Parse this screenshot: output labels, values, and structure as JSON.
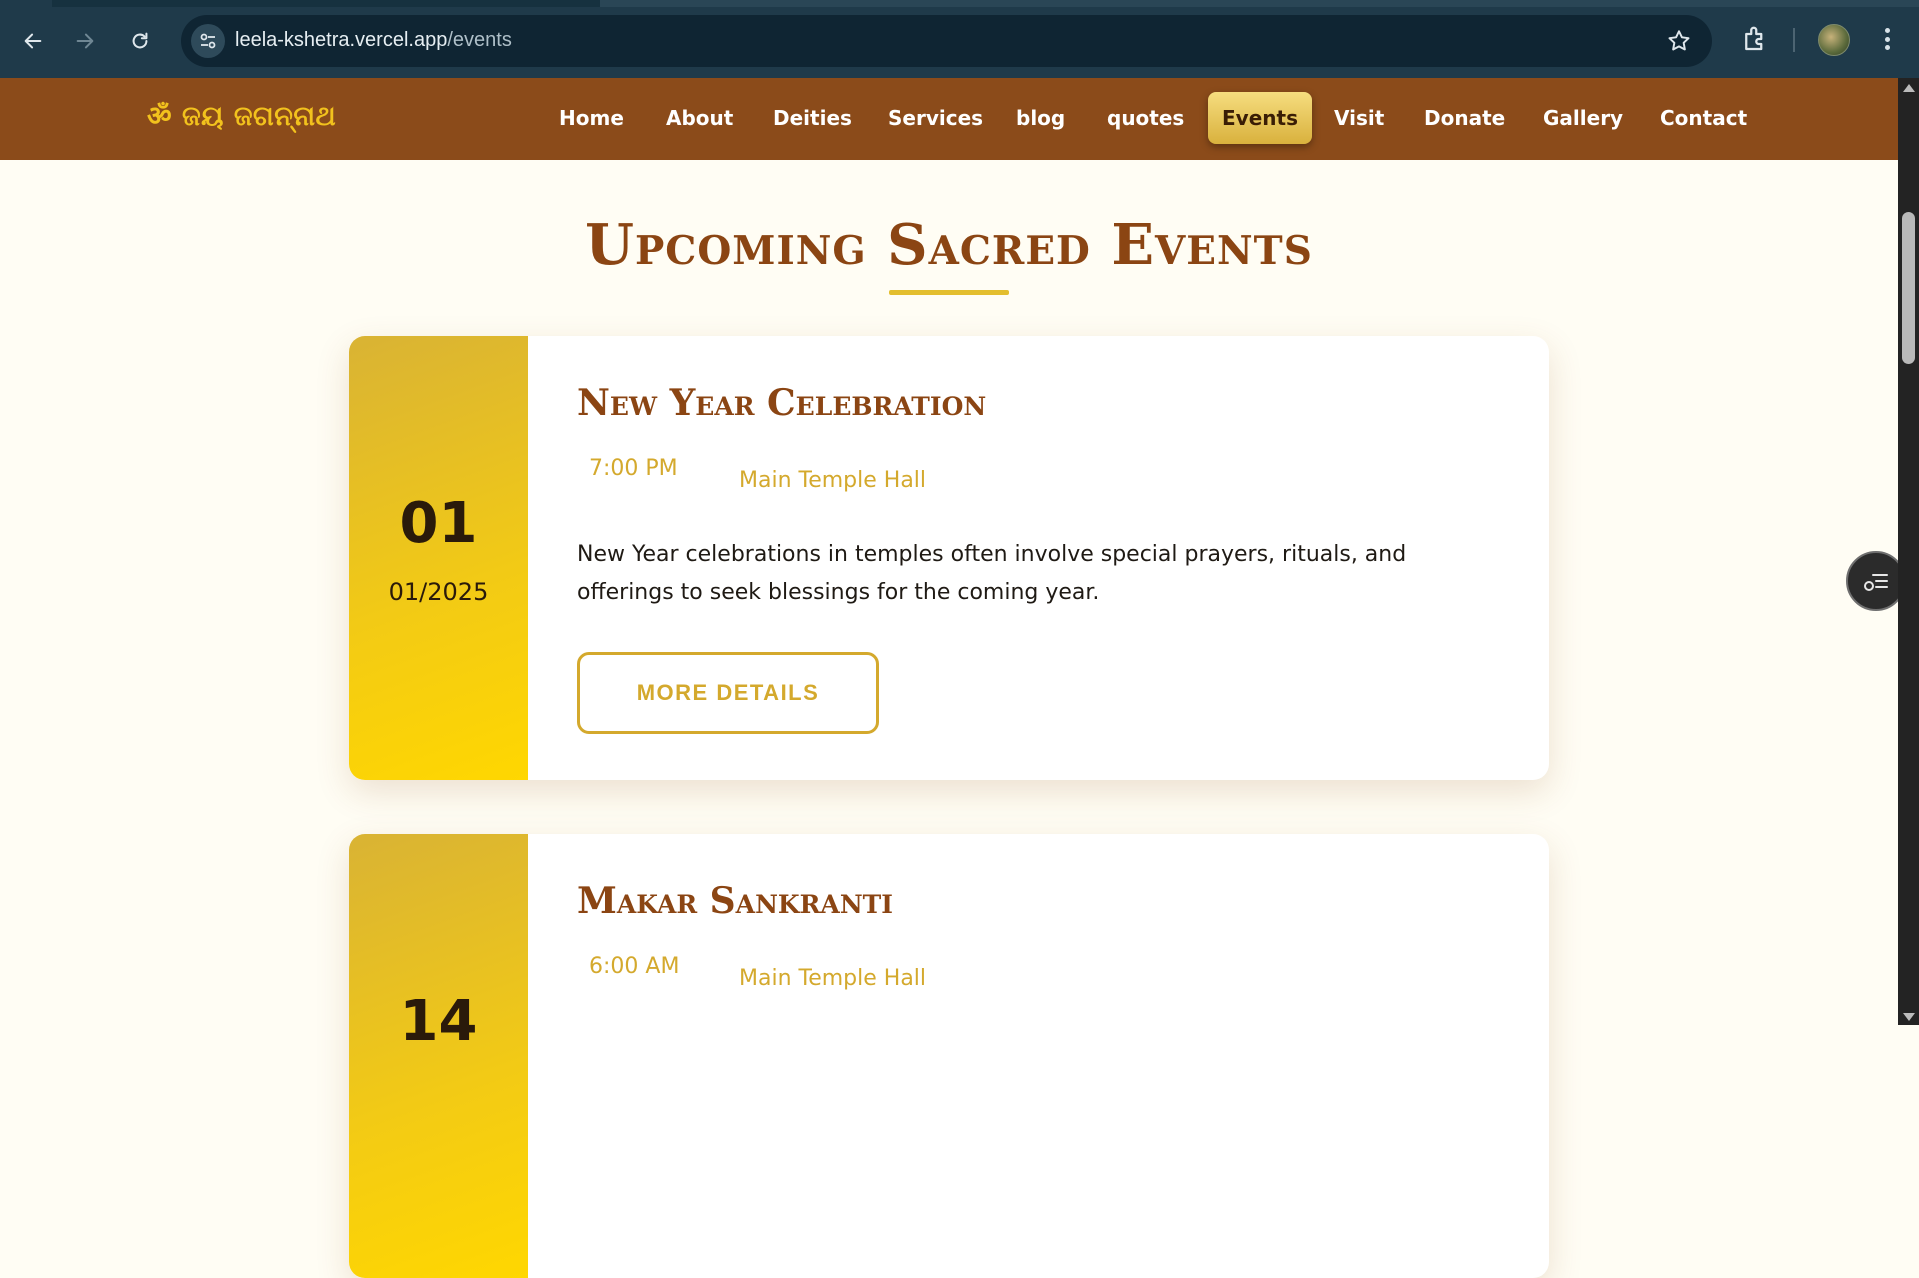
{
  "browser": {
    "url_host": "leela-kshetra.vercel.app",
    "url_path": "/events",
    "icons": [
      "back-icon",
      "forward-icon",
      "reload-icon",
      "site-info-icon",
      "bookmark-star-icon",
      "extensions-icon",
      "profile-avatar",
      "menu-dots-icon"
    ]
  },
  "site": {
    "logo": "ॐ ଜୟ ଜଗନ୍ନାଥ",
    "nav": [
      {
        "label": "Home",
        "active": false
      },
      {
        "label": "About",
        "active": false
      },
      {
        "label": "Deities",
        "active": false
      },
      {
        "label": "Services",
        "active": false
      },
      {
        "label": "blog",
        "active": false
      },
      {
        "label": "quotes",
        "active": false
      },
      {
        "label": "Events",
        "active": true
      },
      {
        "label": "Visit",
        "active": false
      },
      {
        "label": "Donate",
        "active": false
      },
      {
        "label": "Gallery",
        "active": false
      },
      {
        "label": "Contact",
        "active": false
      }
    ]
  },
  "page": {
    "title": "Upcoming Sacred Events",
    "events": [
      {
        "day": "01",
        "month_year": "01/2025",
        "title": "New Year Celebration",
        "time": "7:00 PM",
        "location": "Main Temple Hall",
        "description": "New Year celebrations in temples often involve special prayers, rituals, and offerings to seek blessings for the coming year.",
        "button": "MORE DETAILS"
      },
      {
        "day": "14",
        "title": "Makar Sankranti",
        "time": "6:00 AM",
        "location": "Main Temple Hall"
      }
    ]
  },
  "colors": {
    "nav_bg": "#8b4b1a",
    "accent_gold": "#d4a92d",
    "title_brown": "#8b4513",
    "page_bg": "#fffdf4",
    "date_gold": "#f3cb14"
  }
}
